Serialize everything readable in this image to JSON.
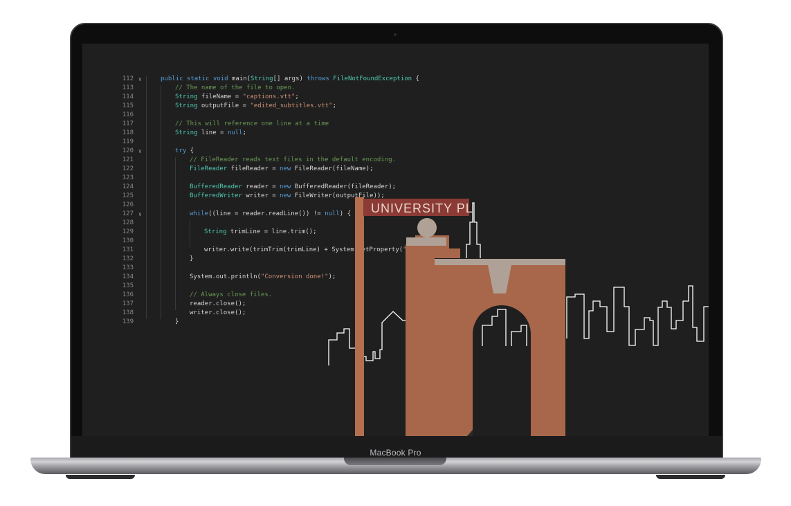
{
  "device": {
    "brand_label": "MacBook Pro"
  },
  "editor": {
    "lines": [
      {
        "n": "112",
        "fold": true,
        "indent": 0,
        "tokens": [
          [
            "kw",
            "public static void "
          ],
          [
            "pl",
            "main("
          ],
          [
            "ty",
            "String"
          ],
          [
            "pl",
            "[] args) "
          ],
          [
            "kw",
            "throws "
          ],
          [
            "ty",
            "FileNotFoundException"
          ],
          [
            "pl",
            " {"
          ]
        ]
      },
      {
        "n": "113",
        "fold": false,
        "indent": 1,
        "tokens": [
          [
            "cm",
            "// The name of the file to open."
          ]
        ]
      },
      {
        "n": "114",
        "fold": false,
        "indent": 1,
        "tokens": [
          [
            "ty",
            "String"
          ],
          [
            "pl",
            " fileName = "
          ],
          [
            "st",
            "\"captions.vtt\""
          ],
          [
            "pl",
            ";"
          ]
        ]
      },
      {
        "n": "115",
        "fold": false,
        "indent": 1,
        "tokens": [
          [
            "ty",
            "String"
          ],
          [
            "pl",
            " outputFile = "
          ],
          [
            "st",
            "\"edited_subtitles.vtt\""
          ],
          [
            "pl",
            ";"
          ]
        ]
      },
      {
        "n": "116",
        "fold": false,
        "indent": 1,
        "tokens": []
      },
      {
        "n": "117",
        "fold": false,
        "indent": 1,
        "tokens": [
          [
            "cm",
            "// This will reference one line at a time"
          ]
        ]
      },
      {
        "n": "118",
        "fold": false,
        "indent": 1,
        "tokens": [
          [
            "ty",
            "String"
          ],
          [
            "pl",
            " line = "
          ],
          [
            "kw",
            "null"
          ],
          [
            "pl",
            ";"
          ]
        ]
      },
      {
        "n": "119",
        "fold": false,
        "indent": 1,
        "tokens": []
      },
      {
        "n": "120",
        "fold": true,
        "indent": 1,
        "tokens": [
          [
            "kw",
            "try"
          ],
          [
            "pl",
            " {"
          ]
        ]
      },
      {
        "n": "121",
        "fold": false,
        "indent": 2,
        "tokens": [
          [
            "cm",
            "// FileReader reads text files in the default encoding."
          ]
        ]
      },
      {
        "n": "122",
        "fold": false,
        "indent": 2,
        "tokens": [
          [
            "ty",
            "FileReader"
          ],
          [
            "pl",
            " fileReader = "
          ],
          [
            "kw",
            "new "
          ],
          [
            "pl",
            "FileReader(fileName);"
          ]
        ]
      },
      {
        "n": "123",
        "fold": false,
        "indent": 2,
        "tokens": []
      },
      {
        "n": "124",
        "fold": false,
        "indent": 2,
        "tokens": [
          [
            "ty",
            "BufferedReader"
          ],
          [
            "pl",
            " reader = "
          ],
          [
            "kw",
            "new "
          ],
          [
            "pl",
            "BufferedReader(fileReader);"
          ]
        ]
      },
      {
        "n": "125",
        "fold": false,
        "indent": 2,
        "tokens": [
          [
            "ty",
            "BufferedWriter"
          ],
          [
            "pl",
            " writer = "
          ],
          [
            "kw",
            "new "
          ],
          [
            "pl",
            "FileWriter(outputFile));"
          ]
        ]
      },
      {
        "n": "126",
        "fold": false,
        "indent": 2,
        "tokens": []
      },
      {
        "n": "127",
        "fold": true,
        "indent": 2,
        "tokens": [
          [
            "kw",
            "while"
          ],
          [
            "pl",
            "((line = reader.readLine()) != "
          ],
          [
            "kw",
            "null"
          ],
          [
            "pl",
            ") {"
          ]
        ]
      },
      {
        "n": "128",
        "fold": false,
        "indent": 3,
        "tokens": []
      },
      {
        "n": "129",
        "fold": false,
        "indent": 3,
        "tokens": [
          [
            "ty",
            "String"
          ],
          [
            "pl",
            " trimLine = line.trim();"
          ]
        ]
      },
      {
        "n": "130",
        "fold": false,
        "indent": 3,
        "tokens": []
      },
      {
        "n": "131",
        "fold": false,
        "indent": 3,
        "tokens": [
          [
            "pl",
            "writer.write(trimTrim(trimLine) + System.getProperty("
          ],
          [
            "st",
            "\"li"
          ],
          [
            "pl",
            "));"
          ]
        ]
      },
      {
        "n": "132",
        "fold": false,
        "indent": 2,
        "tokens": [
          [
            "pl",
            "}"
          ]
        ]
      },
      {
        "n": "133",
        "fold": false,
        "indent": 2,
        "tokens": []
      },
      {
        "n": "134",
        "fold": false,
        "indent": 2,
        "tokens": [
          [
            "pl",
            "System.out.println("
          ],
          [
            "st",
            "\"Conversion done!\""
          ],
          [
            "pl",
            ");"
          ]
        ]
      },
      {
        "n": "135",
        "fold": false,
        "indent": 2,
        "tokens": []
      },
      {
        "n": "136",
        "fold": false,
        "indent": 2,
        "tokens": [
          [
            "cm",
            "// Always close files."
          ]
        ]
      },
      {
        "n": "137",
        "fold": false,
        "indent": 2,
        "tokens": [
          [
            "pl",
            "reader.close();"
          ]
        ]
      },
      {
        "n": "138",
        "fold": false,
        "indent": 2,
        "tokens": [
          [
            "pl",
            "writer.close();"
          ]
        ]
      },
      {
        "n": "139",
        "fold": false,
        "indent": 1,
        "tokens": [
          [
            "pl",
            "}"
          ]
        ]
      }
    ]
  },
  "illustration": {
    "street_sign_text": "UNIVERSITY PL",
    "colors": {
      "arch": "#a8674a",
      "sign": "#8b3a35",
      "pole": "#b4704e",
      "ledge": "#b0a196",
      "skyline": "#ffffff"
    }
  }
}
